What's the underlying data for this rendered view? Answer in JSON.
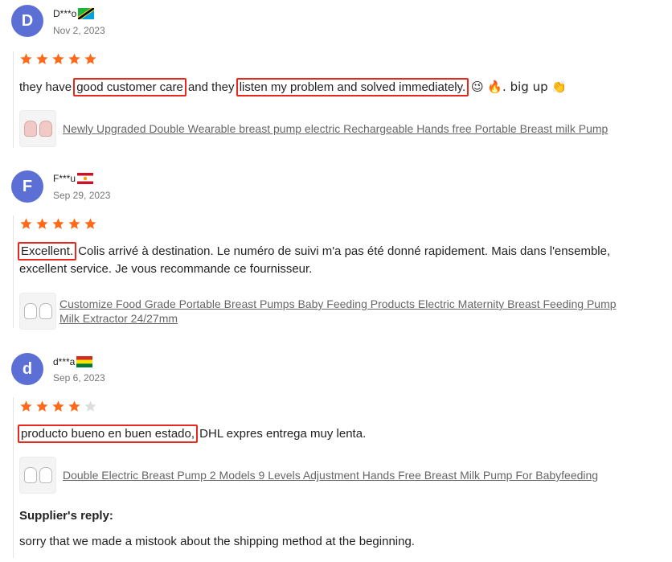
{
  "reviews": [
    {
      "avatar_letter": "D",
      "avatar_color": "#5b6fd4",
      "name": "D***o",
      "flag": "tanzania-flag",
      "date": "Nov 2, 2023",
      "rating": 5,
      "text_parts": [
        "they have ",
        "good customer care",
        " and they ",
        "listen my problem and solved immediately.",
        " 😉 🔥. big up 👏"
      ],
      "product": "Newly Upgraded Double Wearable breast pump electric Rechargeable Hands free Portable Breast milk Pump"
    },
    {
      "avatar_letter": "F",
      "avatar_color": "#5b6fd4",
      "name": "F***u",
      "flag": "french-polynesia-flag",
      "date": "Sep 29, 2023",
      "rating": 5,
      "text_parts": [
        "Excellent.",
        " Colis arrivé à destination. Le numéro de suivi m'a pas été donné rapidement. Mais dans l'ensemble, excellent service. Je vous recommande ce fournisseur."
      ],
      "product_line1": "Customize Food Grade Portable Breast Pumps Baby Feeding Products Electric Maternity Breast Feeding Pump",
      "product_line2": "Milk Extractor 24/27mm"
    },
    {
      "avatar_letter": "d",
      "avatar_color": "#5b6fd4",
      "name": "d***a",
      "flag": "bolivia-flag",
      "date": "Sep 6, 2023",
      "rating": 4,
      "text_parts": [
        "producto bueno en buen estado,",
        " DHL expres entrega muy lenta."
      ],
      "product": "Double Electric Breast Pump 2 Models 9 Levels Adjustment Hands Free Breast Milk Pump For Babyfeeding",
      "reply_title": "Supplier's reply:",
      "reply_text": "sorry that we made a mistook about the shipping method at the beginning."
    }
  ],
  "colors": {
    "star": "#ff6a1a",
    "star_empty": "#dddddd",
    "highlight_box": "#e8281e",
    "avatar": "#5b6fd4"
  }
}
